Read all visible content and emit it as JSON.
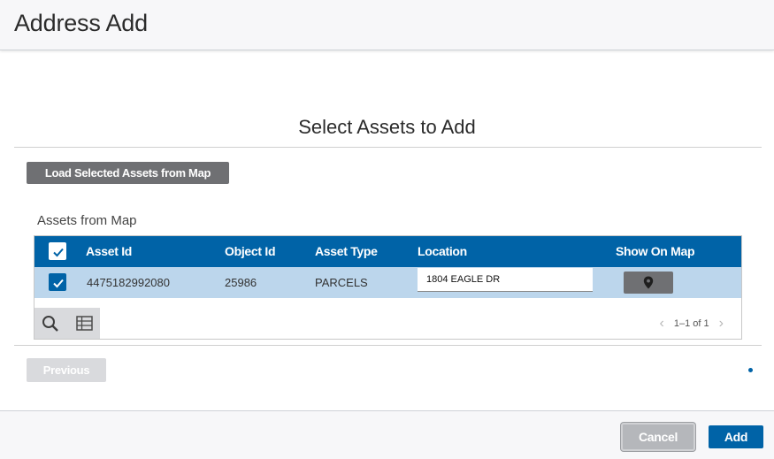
{
  "header": {
    "title": "Address Add"
  },
  "section": {
    "title": "Select Assets to Add"
  },
  "load_button": {
    "label": "Load Selected Assets from Map"
  },
  "assets_label": "Assets from Map",
  "grid": {
    "columns": {
      "asset_id": "Asset Id",
      "object_id": "Object Id",
      "asset_type": "Asset Type",
      "location": "Location",
      "show_on_map": "Show On Map"
    },
    "rows": [
      {
        "asset_id": "4475182992080",
        "object_id": "25986",
        "asset_type": "PARCELS",
        "location": "1804 EAGLE DR",
        "selected": true
      }
    ],
    "pager": "1–1 of 1"
  },
  "nav": {
    "previous_label": "Previous"
  },
  "footer": {
    "cancel_label": "Cancel",
    "add_label": "Add"
  },
  "icons": {
    "search": "search-icon",
    "columns": "table-icon",
    "map_pin": "map-pin-icon",
    "check": "check-icon",
    "prev": "chevron-left-icon",
    "next": "chevron-right-icon"
  },
  "colors": {
    "primary": "#0063a7",
    "row_selected": "#bcd6ec",
    "button_gray": "#6f7073"
  }
}
